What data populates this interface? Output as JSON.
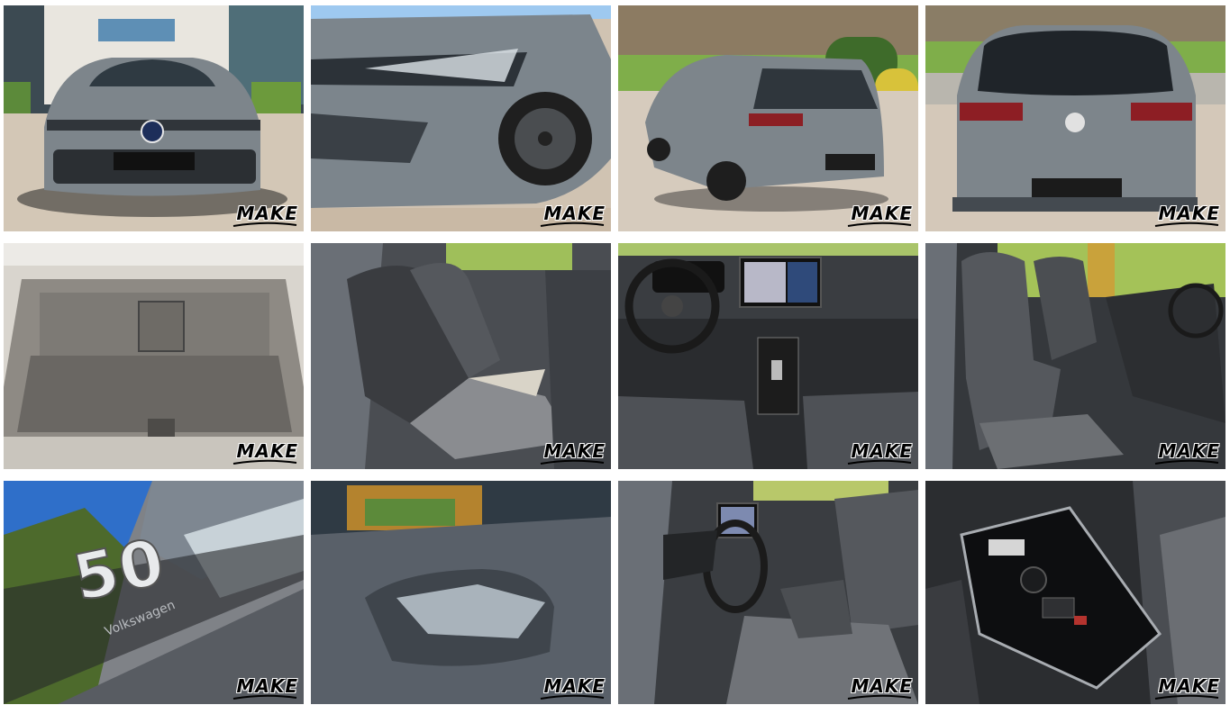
{
  "gallery": {
    "watermark": "MAKE",
    "photos": [
      {
        "subject": "front view"
      },
      {
        "subject": "front headlight detail"
      },
      {
        "subject": "rear three-quarter view"
      },
      {
        "subject": "rear view"
      },
      {
        "subject": "trunk"
      },
      {
        "subject": "rear seats"
      },
      {
        "subject": "dashboard"
      },
      {
        "subject": "front seats"
      },
      {
        "subject": "50 badge",
        "badge_text": "50",
        "badge_sub": "Volkswagen"
      },
      {
        "subject": "rear window"
      },
      {
        "subject": "driver cockpit"
      },
      {
        "subject": "center console"
      }
    ]
  },
  "colors": {
    "car_grey": "#7e858b",
    "sky": "#9ec9f0",
    "pavement": "#d9cdbd",
    "grass": "#7fae4a",
    "upholstery": "#3b3d40",
    "trunk_lining": "#8e8a84"
  }
}
